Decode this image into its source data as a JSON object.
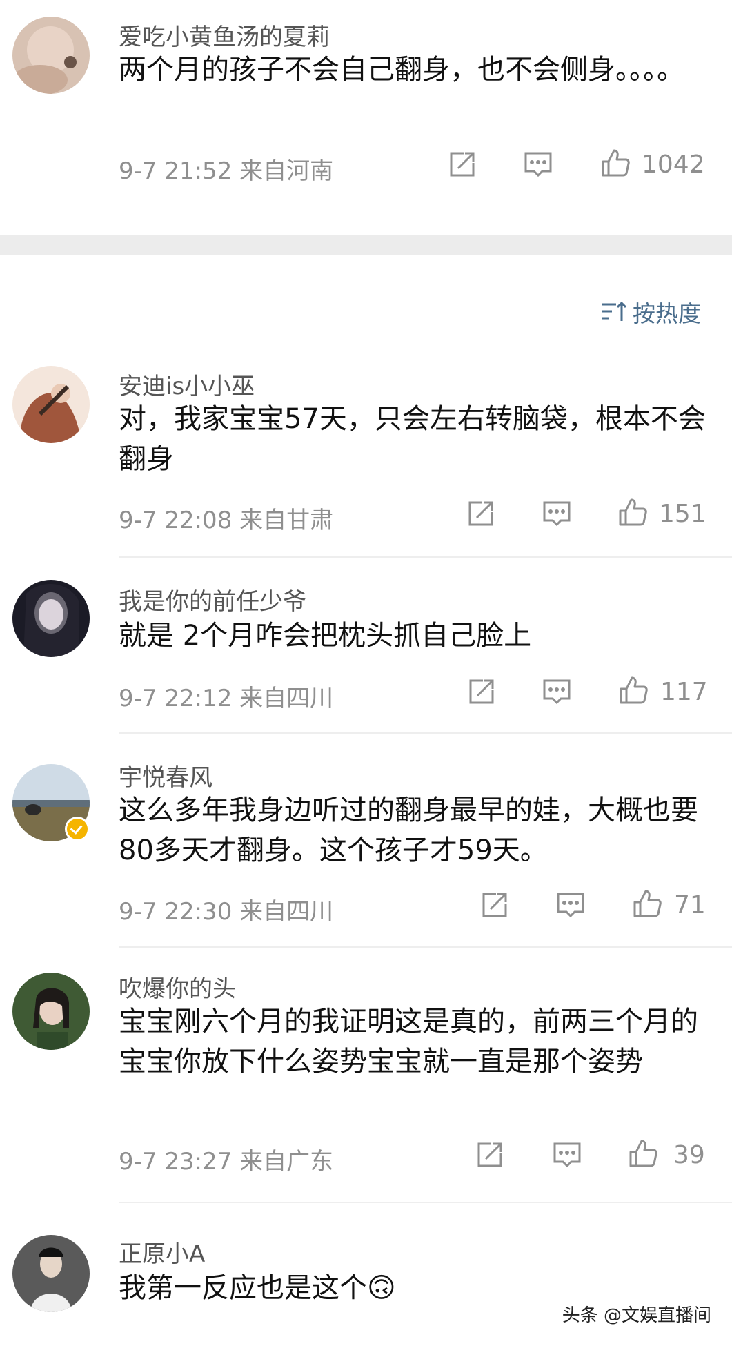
{
  "sort": {
    "label": "按热度"
  },
  "comments": [
    {
      "username": "爱吃小黄鱼汤的夏莉",
      "text": "两个月的孩子不会自己翻身，也不会侧身。。。。",
      "timestamp": "9-7 21:52",
      "location": "来自河南",
      "likes": "1042"
    },
    {
      "username": "安迪is小小巫",
      "text": "对，我家宝宝57天，只会左右转脑袋，根本不会翻身",
      "timestamp": "9-7 22:08",
      "location": "来自甘肃",
      "likes": "151"
    },
    {
      "username": "我是你的前任少爷",
      "text": "就是 2个月咋会把枕头抓自己脸上",
      "timestamp": "9-7 22:12",
      "location": "来自四川",
      "likes": "117"
    },
    {
      "username": "宇悦春风",
      "text": "这么多年我身边听过的翻身最早的娃，大概也要80多天才翻身。这个孩子才59天。",
      "timestamp": "9-7 22:30",
      "location": "来自四川",
      "likes": "71",
      "verified": true
    },
    {
      "username": "吹爆你的头",
      "text": "宝宝刚六个月的我证明这是真的，前两三个月的宝宝你放下什么姿势宝宝就一直是那个姿势",
      "timestamp": "9-7 23:27",
      "location": "来自广东",
      "likes": "39"
    },
    {
      "username": "正原小A",
      "text": "我第一反应也是这个🙃"
    }
  ],
  "watermark": "头条 @文娱直播间",
  "icons": [
    "share-icon",
    "comment-icon",
    "like-icon",
    "sort-icon",
    "verified-badge-icon"
  ]
}
